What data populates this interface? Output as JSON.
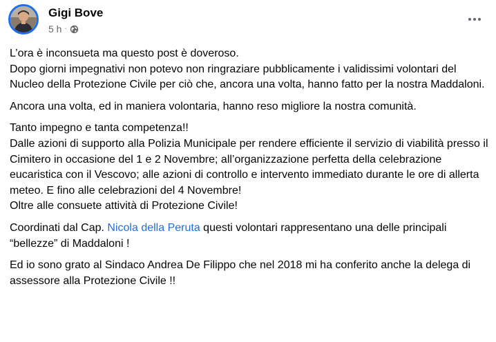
{
  "post": {
    "author": "Gigi Bove",
    "timestamp": "5 h",
    "separator": "·",
    "privacy_icon": "globe-icon",
    "more_icon": "more-options-icon",
    "paragraphs": [
      "L’ora è inconsueta ma questo post è doveroso.\nDopo giorni impegnativi non potevo non ringraziare pubblicamente i validissimi volontari del Nucleo della Protezione Civile per ciò che, ancora una volta, hanno fatto per la nostra Maddaloni.",
      "Ancora una volta, ed in maniera volontaria, hanno reso migliore la nostra comunità.",
      "Tanto impegno  e tanta competenza!!\nDalle azioni di supporto alla Polizia Municipale per rendere efficiente il servizio di viabilità presso il Cimitero in occasione del 1 e 2 Novembre; all’organizzazione perfetta della celebrazione eucaristica con il Vescovo; alle azioni di controllo e intervento immediato durante le ore di allerta meteo. E fino alle celebrazioni del 4 Novembre!\nOltre alle consuete attività di Protezione Civile!"
    ],
    "coord_before": "Coordinati dal Cap. ",
    "mention": "Nicola della Peruta",
    "coord_after": " questi volontari rappresentano una delle principali “bellezze” di Maddaloni !",
    "last_paragraph": "Ed io sono grato al Sindaco Andrea De Filippo che nel 2018 mi ha conferito anche la delega di assessore alla Protezione Civile !!"
  },
  "colors": {
    "text": "#050505",
    "meta": "#65676b",
    "link": "#216fdb",
    "avatar_ring": "#1f6feb"
  }
}
